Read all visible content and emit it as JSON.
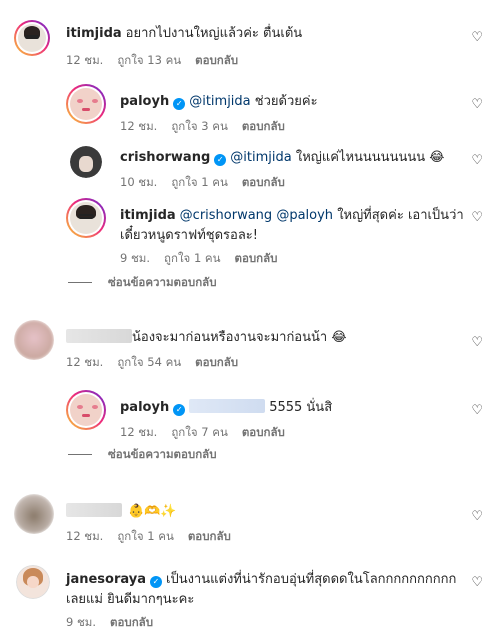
{
  "comments": [
    {
      "user": "itimjida",
      "text": "อยากไปงานใหญ่แล้วค่ะ ตื่นเต้น",
      "time": "12 ชม.",
      "likes": "ถูกใจ 13 คน",
      "reply": "ตอบกลับ"
    },
    {
      "user": "paloyh",
      "mention": "@itimjida",
      "text": "ช่วยด้วยค่ะ",
      "time": "12 ชม.",
      "likes": "ถูกใจ 3 คน",
      "reply": "ตอบกลับ"
    },
    {
      "user": "crishorwang",
      "mention": "@itimjida",
      "text": "ใหญ่แค่ไหนนนนนนนน 😂",
      "time": "10 ชม.",
      "likes": "ถูกใจ 1 คน",
      "reply": "ตอบกลับ"
    },
    {
      "user": "itimjida",
      "mention1": "@crishorwang",
      "mention2": "@paloyh",
      "text_line1": "ใหญ่ที่สุดค่ะ เอาเป็นว่า",
      "text_line2": "เดี๋ยวหนูดราฟท์ชุดรอละ!",
      "time": "9 ชม.",
      "likes": "ถูกใจ 1 คน",
      "reply": "ตอบกลับ"
    },
    {
      "text": "น้องจะมาก่อนหรืองานจะมาก่อนน้า 😂",
      "time": "12 ชม.",
      "likes": "ถูกใจ 54 คน",
      "reply": "ตอบกลับ"
    },
    {
      "user": "paloyh",
      "text": "5555 นั่นสิ",
      "time": "12 ชม.",
      "likes": "ถูกใจ 7 คน",
      "reply": "ตอบกลับ"
    },
    {
      "text": "👶🫶✨",
      "time": "12 ชม.",
      "likes": "ถูกใจ 1 คน",
      "reply": "ตอบกลับ"
    },
    {
      "user": "janesoraya",
      "text_line1": "เป็นงานแต่งที่น่ารักอบอุ่นที่สุดดดในโลกกกกกกกกกก",
      "text_line2": "เลยแม่ ยินดีมากๆนะคะ",
      "time": "9 ชม.",
      "reply": "ตอบกลับ"
    }
  ],
  "hide_replies": "ซ่อนข้อความตอบกลับ",
  "icons": {
    "like": "heart-outline-icon",
    "verified": "verified-badge-icon"
  },
  "colors": {
    "mention": "#00376b",
    "verified": "#0095f6",
    "meta": "#737373"
  }
}
